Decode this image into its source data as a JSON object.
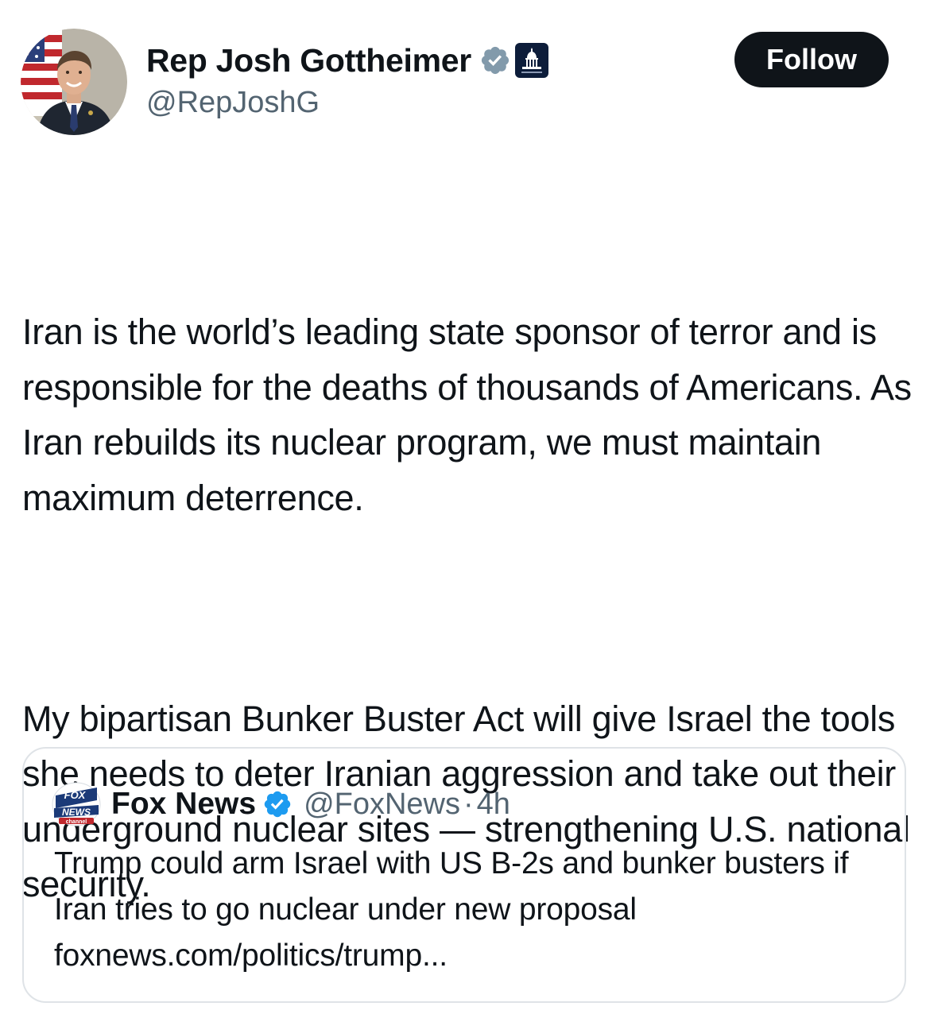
{
  "author": {
    "display_name": "Rep Josh Gottheimer",
    "handle": "@RepJoshG",
    "verified_badge_color": "#829aab",
    "affiliation_badge": "us-capitol-icon"
  },
  "follow_button": {
    "label": "Follow",
    "color": "#0f1419"
  },
  "tweet": {
    "paragraphs": [
      "Iran is the world’s leading state sponsor of terror and is responsible for the deaths of thousands of Americans. As Iran rebuilds its nuclear program, we must maintain maximum deterrence.",
      "My bipartisan Bunker Buster Act will give Israel the tools she needs to deter Iranian aggression and take out their underground nuclear sites — strengthening U.S. national security."
    ]
  },
  "quoted_tweet": {
    "display_name": "Fox News",
    "handle": "@FoxNews",
    "separator": "·",
    "time": "4h",
    "verified_badge_color": "#1d9bf0",
    "text": "Trump could arm Israel with US B-2s and bunker busters if Iran tries to go nuclear under new proposal foxnews.com/politics/trump...",
    "logo": {
      "line1": "FOX",
      "line2": "NEWS",
      "line3": "channel"
    }
  }
}
